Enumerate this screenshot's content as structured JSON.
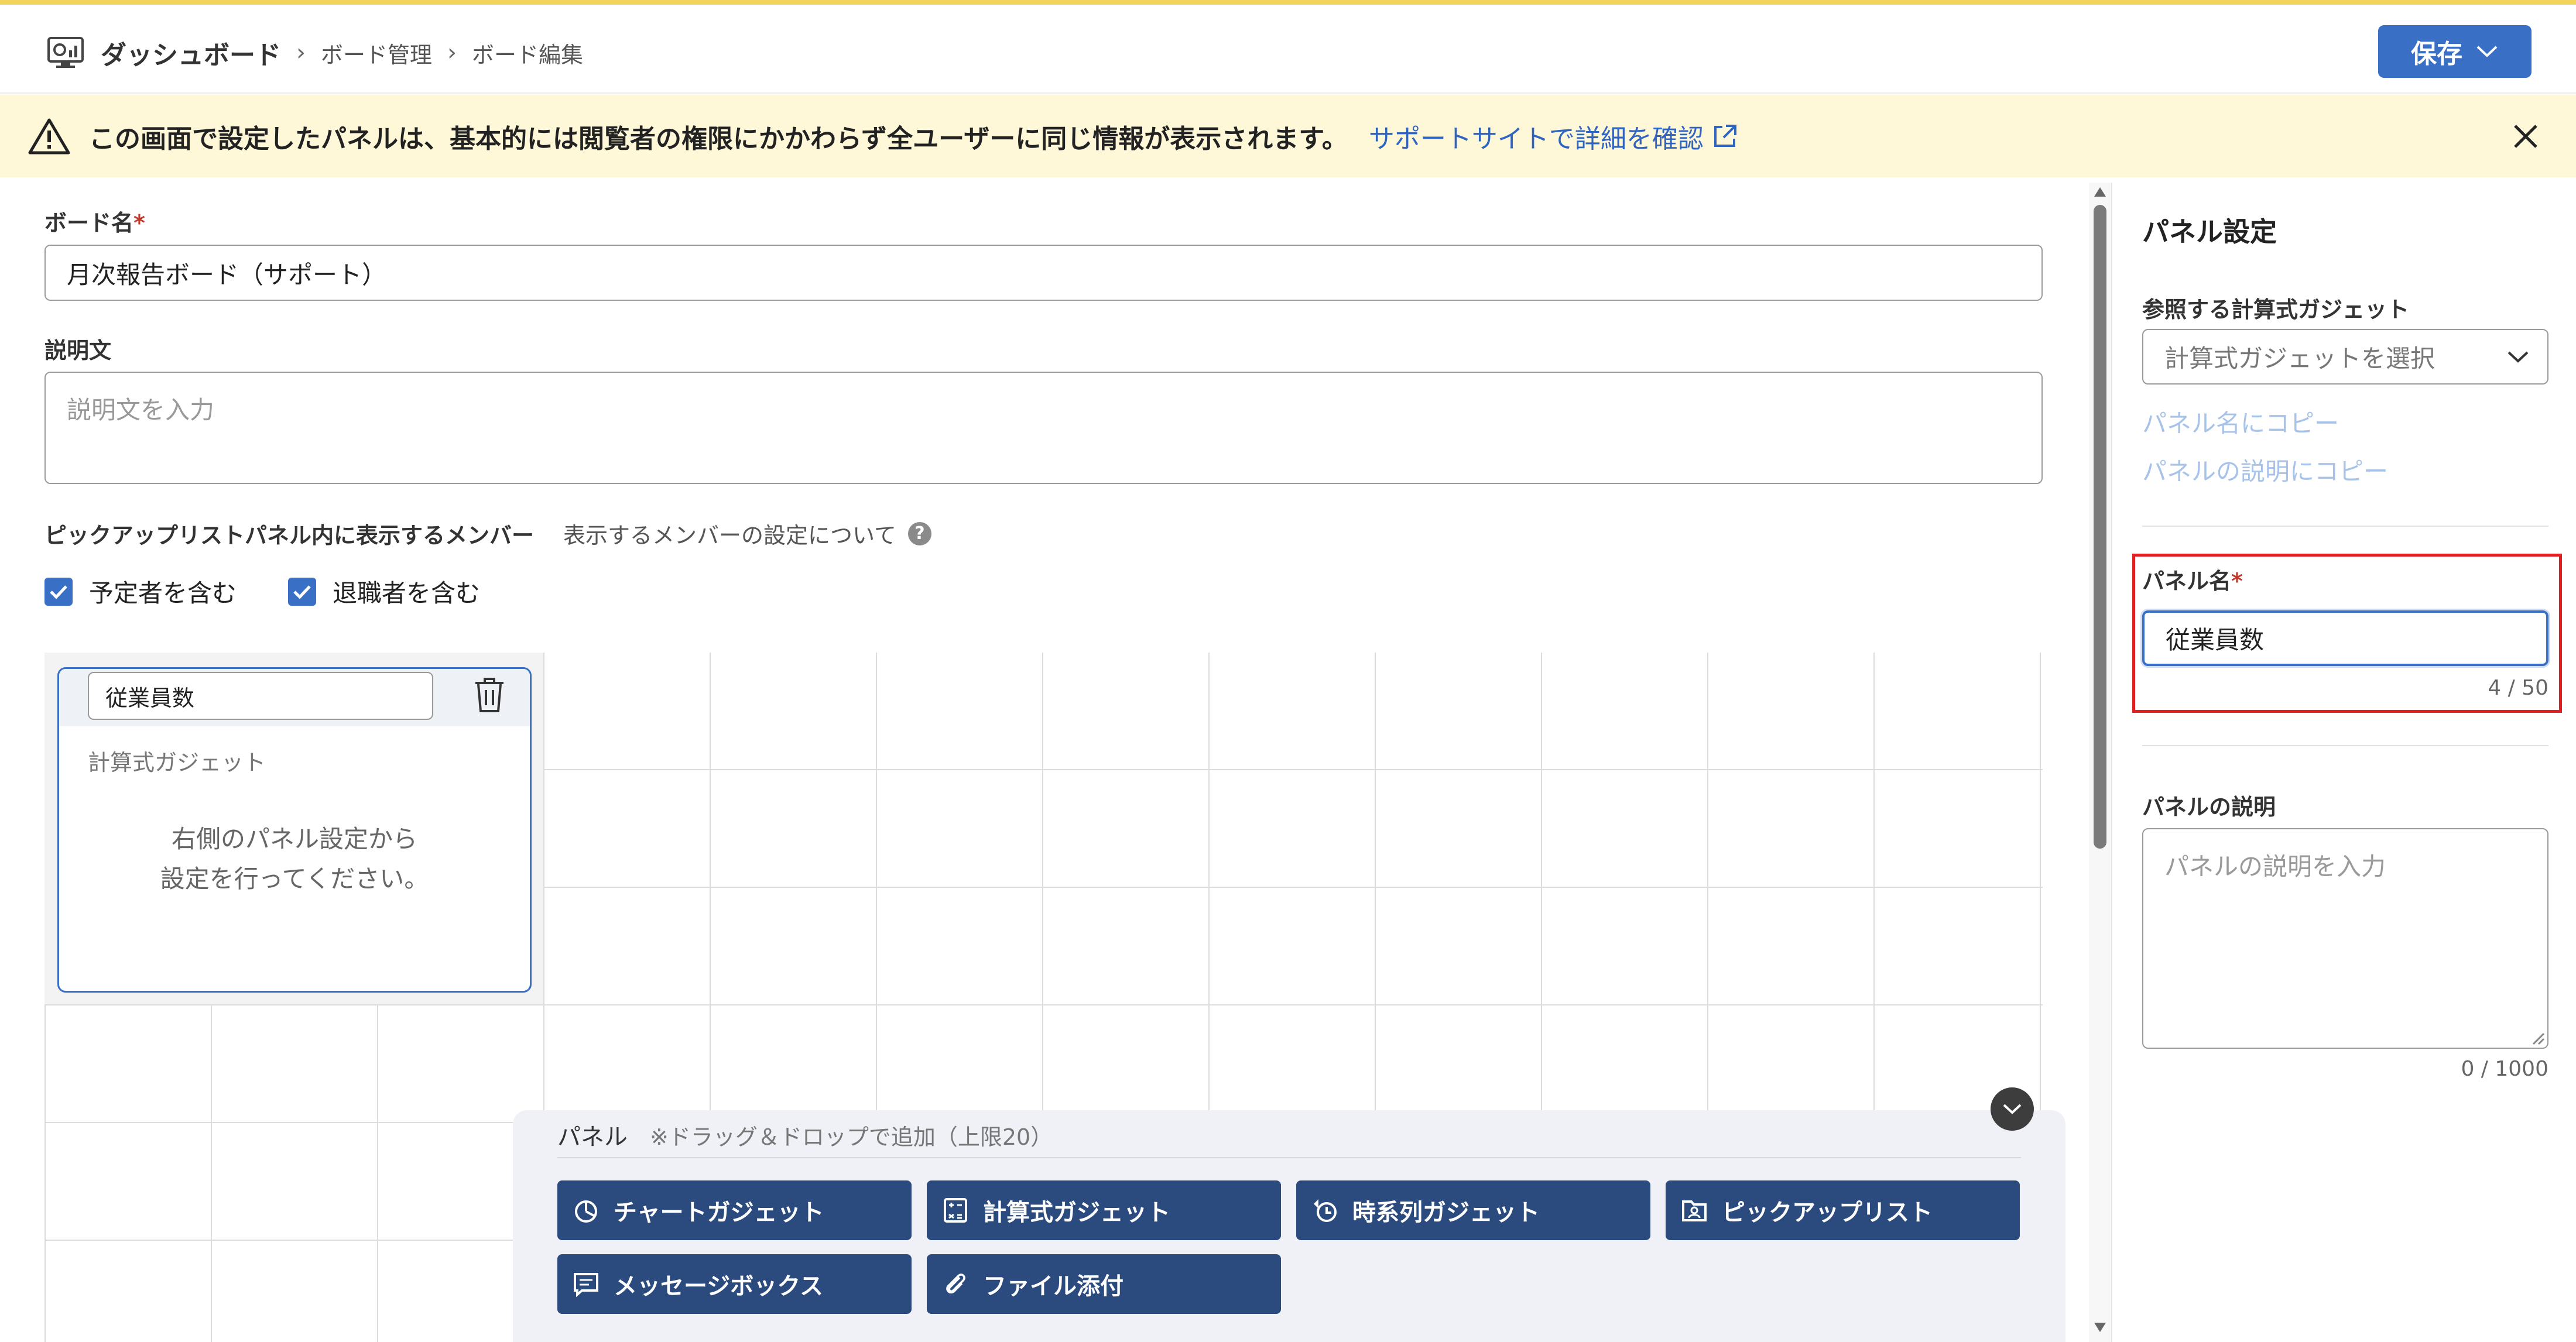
{
  "header": {
    "app_title": "ダッシュボード",
    "breadcrumbs": [
      "ボード管理",
      "ボード編集"
    ],
    "save_label": "保存"
  },
  "notice": {
    "message": "この画面で設定したパネルは、基本的には閲覧者の権限にかかわらず全ユーザーに同じ情報が表示されます。",
    "link_text": "サポートサイトで詳細を確認"
  },
  "form": {
    "board_name_label": "ボード名",
    "required_mark": "*",
    "board_name_value": "月次報告ボード（サポート）",
    "description_label": "説明文",
    "description_placeholder": "説明文を入力",
    "members_label": "ピックアップリストパネル内に表示するメンバー",
    "members_help_text": "表示するメンバーの設定について",
    "checkbox_scheduled": "予定者を含む",
    "checkbox_retired": "退職者を含む"
  },
  "panel_card": {
    "name_value": "従業員数",
    "type_label": "計算式ガジェット",
    "message_line1": "右側のパネル設定から",
    "message_line2": "設定を行ってください。"
  },
  "palette": {
    "title": "パネル",
    "hint": "※ドラッグ＆ドロップで追加（上限20）",
    "buttons": [
      {
        "label": "チャートガジェット",
        "icon": "pie-chart-icon"
      },
      {
        "label": "計算式ガジェット",
        "icon": "calculator-icon"
      },
      {
        "label": "時系列ガジェット",
        "icon": "time-series-icon"
      },
      {
        "label": "ピックアップリスト",
        "icon": "pickup-list-icon"
      },
      {
        "label": "メッセージボックス",
        "icon": "message-icon"
      },
      {
        "label": "ファイル添付",
        "icon": "paperclip-icon"
      }
    ]
  },
  "settings": {
    "title": "パネル設定",
    "ref_gadget_label": "参照する計算式ガジェット",
    "ref_gadget_placeholder": "計算式ガジェットを選択",
    "copy_to_name": "パネル名にコピー",
    "copy_to_desc": "パネルの説明にコピー",
    "panel_name_label": "パネル名",
    "panel_name_value": "従業員数",
    "panel_name_count": "4 / 50",
    "panel_desc_label": "パネルの説明",
    "panel_desc_placeholder": "パネルの説明を入力",
    "panel_desc_count": "0 / 1000"
  },
  "colors": {
    "accent": "#3a6fc6",
    "palette_button": "#2b4a7e",
    "notice_bg": "#fef7d8",
    "highlight": "#e02020"
  }
}
